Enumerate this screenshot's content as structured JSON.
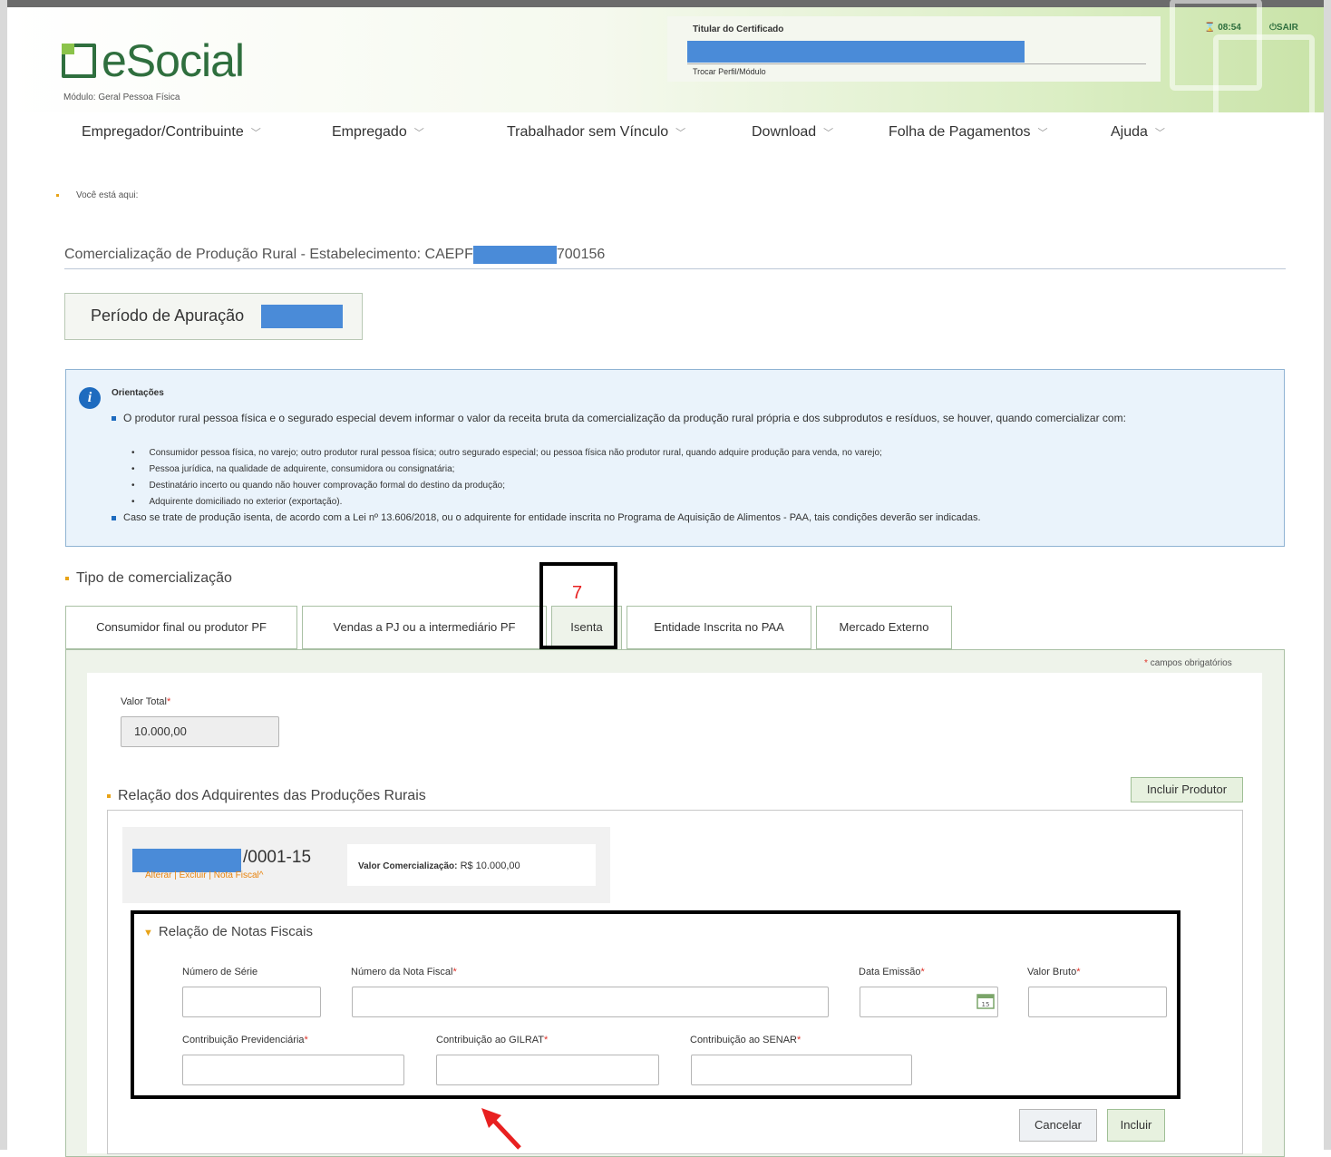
{
  "header": {
    "logo_text": "eSocial",
    "module": "Módulo: Geral Pessoa Física",
    "cert_title": "Titular do Certificado",
    "switch_profile": "Trocar Perfil/Módulo",
    "timer": "08:54",
    "logout": "SAIR"
  },
  "nav": [
    {
      "label": "Empregador/Contribuinte"
    },
    {
      "label": "Empregado"
    },
    {
      "label": "Trabalhador sem Vínculo"
    },
    {
      "label": "Download"
    },
    {
      "label": "Folha de Pagamentos"
    },
    {
      "label": "Ajuda"
    }
  ],
  "breadcrumb": "Você está aqui:",
  "page_title": {
    "prefix": "Comercialização de Produção Rural - Estabelecimento: CAEPF",
    "suffix": "700156"
  },
  "periodo_label": "Período de Apuração",
  "info": {
    "title": "Orientações",
    "p1": "O produtor rural pessoa física e o segurado especial devem informar o valor da receita bruta da comercialização da produção rural própria e dos subprodutos e resíduos, se houver, quando comercializar com:",
    "items": [
      "Consumidor pessoa física, no varejo; outro produtor rural pessoa física; outro segurado especial; ou pessoa física não produtor rural, quando adquire produção para venda, no varejo;",
      "Pessoa jurídica, na qualidade de adquirente, consumidora ou consignatária;",
      "Destinatário incerto ou quando não houver comprovação formal do destino da produção;",
      "Adquirente domiciliado no exterior (exportação)."
    ],
    "p2": "Caso se trate de produção isenta, de acordo com a Lei nº 13.606/2018, ou o adquirente for entidade inscrita no Programa de Aquisição de Alimentos - PAA, tais condições deverão ser indicadas."
  },
  "tipo_heading": "Tipo de comercialização",
  "tabs": [
    {
      "label": "Consumidor final ou produtor PF"
    },
    {
      "label": "Vendas a PJ ou a intermediário PF"
    },
    {
      "label": "Isenta"
    },
    {
      "label": "Entidade Inscrita no PAA"
    },
    {
      "label": "Mercado Externo"
    }
  ],
  "annotation_number": "7",
  "required_note": "campos obrigatórios",
  "valor_total": {
    "label": "Valor Total",
    "value": "10.000,00"
  },
  "adquirentes_heading": "Relação dos Adquirentes das Produções Rurais",
  "incluir_produtor": "Incluir Produtor",
  "card": {
    "cnpj_suffix": "/0001-15",
    "links": "Alterar | Excluir | Nota Fiscal^",
    "valor_label": "Valor Comercialização:",
    "valor_value": "R$ 10.000,00"
  },
  "notas": {
    "title": "Relação de Notas Fiscais",
    "numero_serie": "Número de Série",
    "numero_nota": "Número da Nota Fiscal",
    "data_emissao": "Data Emissão",
    "valor_bruto": "Valor Bruto",
    "contrib_prev": "Contribuição Previdenciária",
    "contrib_gilrat": "Contribuição ao GILRAT",
    "contrib_senar": "Contribuição ao SENAR",
    "calendar_day": "15"
  },
  "buttons": {
    "cancelar": "Cancelar",
    "incluir": "Incluir"
  },
  "required_star": "*",
  "colors": {
    "brand_green": "#2f6f3e",
    "mask_blue": "#4a8bd8",
    "accent_orange": "#e8a317",
    "annotation_red": "#e82020"
  }
}
